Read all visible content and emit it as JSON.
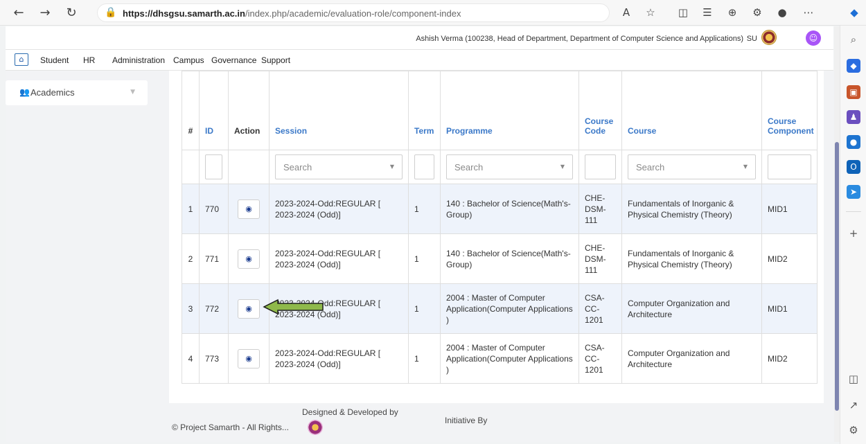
{
  "browser": {
    "url_host": "https://dhsgsu.samarth.ac.in",
    "url_path": "/index.php/academic/evaluation-role/component-index"
  },
  "header": {
    "user": "Ashish Verma (100238, Head of Department, Department of Computer Science and Applications)",
    "su": "SU"
  },
  "menu": [
    "Student",
    "HR",
    "Administration",
    "Campus",
    "Governance",
    "Support"
  ],
  "sidebar": {
    "academics": "Academics"
  },
  "table": {
    "headers": {
      "num": "#",
      "id": "ID",
      "action": "Action",
      "session": "Session",
      "term": "Term",
      "programme": "Programme",
      "course_code": "Course Code",
      "course": "Course",
      "course_component": "Course Component"
    },
    "filters": {
      "session_placeholder": "Search",
      "programme_placeholder": "Search",
      "course_placeholder": "Search"
    },
    "rows": [
      {
        "num": "1",
        "id": "770",
        "session": "2023-2024-Odd:REGULAR [ 2023-2024 (Odd)]",
        "term": "1",
        "programme": "140 : Bachelor of Science(Math's-Group)",
        "course_code": "CHE-DSM-111",
        "course": "Fundamentals of Inorganic & Physical Chemistry (Theory)",
        "component": "MID1"
      },
      {
        "num": "2",
        "id": "771",
        "session": "2023-2024-Odd:REGULAR [ 2023-2024 (Odd)]",
        "term": "1",
        "programme": "140 : Bachelor of Science(Math's-Group)",
        "course_code": "CHE-DSM-111",
        "course": "Fundamentals of Inorganic & Physical Chemistry (Theory)",
        "component": "MID2"
      },
      {
        "num": "3",
        "id": "772",
        "session": "2023-2024-Odd:REGULAR [ 2023-2024 (Odd)]",
        "term": "1",
        "programme": "2004 : Master of Computer Application(Computer Applications )",
        "course_code": "CSA-CC-1201",
        "course": "Computer Organization and Architecture",
        "component": "MID1"
      },
      {
        "num": "4",
        "id": "773",
        "session": "2023-2024-Odd:REGULAR [ 2023-2024 (Odd)]",
        "term": "1",
        "programme": "2004 : Master of Computer Application(Computer Applications )",
        "course_code": "CSA-CC-1201",
        "course": "Computer Organization and Architecture",
        "component": "MID2"
      }
    ]
  },
  "footer": {
    "copyright": "© Project Samarth - All Rights...",
    "designed": "Designed & Developed by",
    "initiative": "Initiative By"
  },
  "colors": {
    "header_blue": "#3a78c8",
    "row_highlight": "#eef3fb",
    "arrow_green": "#8fb94b"
  }
}
